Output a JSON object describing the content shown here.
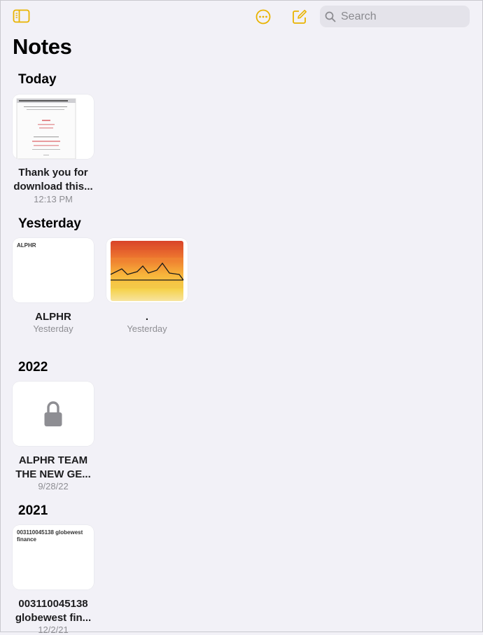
{
  "toolbar": {
    "search_placeholder": "Search",
    "accent_color": "#e9b300"
  },
  "title": "Notes",
  "sections": [
    {
      "header": "Today",
      "notes": [
        {
          "title_line1": "Thank you for",
          "title_line2": "download this...",
          "date": "12:13 PM",
          "preview": "Thank you for download this font. Please"
        }
      ]
    },
    {
      "header": "Yesterday",
      "notes": [
        {
          "title_line1": "ALPHR",
          "title_line2": "",
          "date": "Yesterday",
          "preview": "ALPHR"
        },
        {
          "title_line1": ".",
          "title_line2": "",
          "date": "Yesterday",
          "preview": ""
        }
      ]
    },
    {
      "header": "2022",
      "notes": [
        {
          "title_line1": "ALPHR TEAM",
          "title_line2": "THE NEW GE...",
          "date": "9/28/22",
          "preview": "",
          "locked": true
        }
      ]
    },
    {
      "header": "2021",
      "notes": [
        {
          "title_line1": "003110045138",
          "title_line2": "globewest fin...",
          "date": "12/2/21",
          "preview": "003110045138 globewest finance"
        }
      ]
    }
  ]
}
